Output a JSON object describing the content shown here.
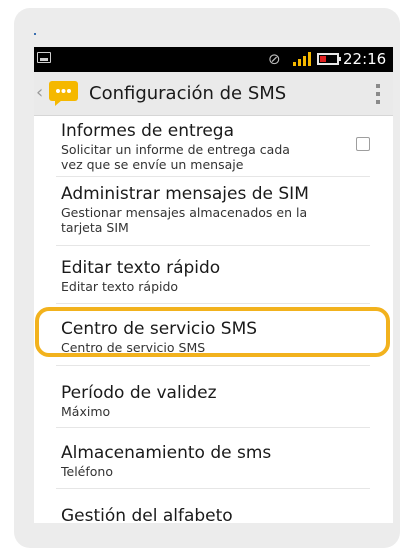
{
  "status_bar": {
    "time": "22:16",
    "icons": [
      "image-notification-icon",
      "mute-icon",
      "signal-icon",
      "battery-icon"
    ],
    "battery_color": "#e02020",
    "signal_color": "#f5b800"
  },
  "action_bar": {
    "title": "Configuración de SMS",
    "app_icon": "messaging-icon",
    "app_icon_color": "#f5b800",
    "back_icon": "chevron-left-icon",
    "overflow_icon": "overflow-menu-icon"
  },
  "preferences": [
    {
      "title": "Informes de entrega",
      "summary": "Solicitar un informe de entrega cada vez que se envíe un mensaje",
      "has_checkbox": true,
      "checked": false
    },
    {
      "title": "Administrar mensajes de SIM",
      "summary": "Gestionar mensajes almacenados en la tarjeta SIM"
    },
    {
      "title": "Editar texto rápido",
      "summary": "Editar texto rápido"
    },
    {
      "title": "Centro de servicio SMS",
      "summary": "Centro de servicio SMS",
      "highlighted": true
    },
    {
      "title": "Período de validez",
      "summary": "Máximo"
    },
    {
      "title": "Almacenamiento de sms",
      "summary": "Teléfono"
    },
    {
      "title": "Gestión del alfabeto",
      "summary": ""
    }
  ],
  "highlight_color": "#f2b21d"
}
